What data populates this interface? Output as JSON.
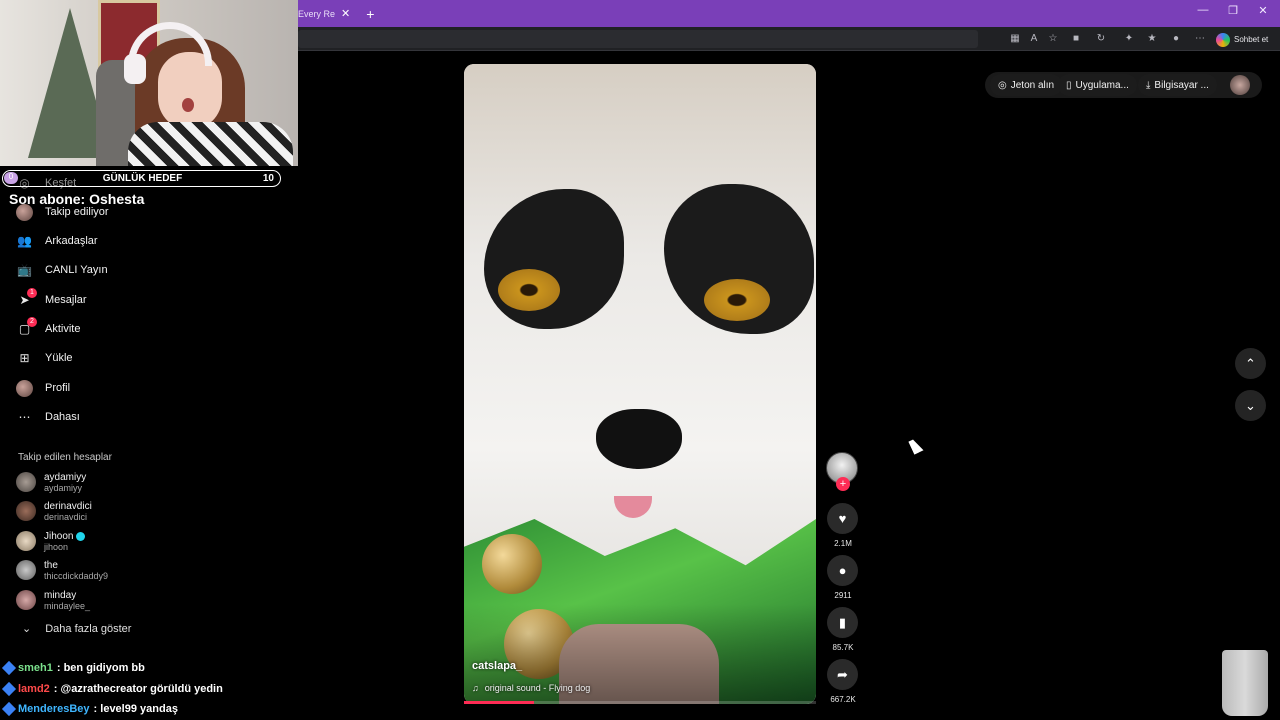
{
  "browser": {
    "tab_fragment": "Every Re",
    "copilot_label": "Sohbet et"
  },
  "goal": {
    "label": "GÜNLÜK HEDEF",
    "current": "0",
    "target": "10",
    "progress_fraction": 0.0
  },
  "last_sub": "Son abone: Oshesta",
  "sidebar": {
    "items": [
      {
        "label": "Keşfet",
        "icon": "compass-icon"
      },
      {
        "label": "Takip ediliyor",
        "icon": "avatar-icon"
      },
      {
        "label": "Arkadaşlar",
        "icon": "friends-icon"
      },
      {
        "label": "CANLI Yayın",
        "icon": "live-tv-icon"
      },
      {
        "label": "Mesajlar",
        "icon": "paper-plane-icon",
        "badge": "1"
      },
      {
        "label": "Aktivite",
        "icon": "activity-icon",
        "badge": "2"
      },
      {
        "label": "Yükle",
        "icon": "upload-plus-icon"
      },
      {
        "label": "Profil",
        "icon": "profile-avatar-icon"
      },
      {
        "label": "Dahası",
        "icon": "more-dots-icon"
      }
    ],
    "following_title": "Takip edilen hesaplar",
    "accounts": [
      {
        "name": "aydamiyy",
        "handle": "aydamiyy",
        "verified": false
      },
      {
        "name": "derinavdici",
        "handle": "derinavdici",
        "verified": false
      },
      {
        "name": "Jihoon",
        "handle": "jihoon",
        "verified": true
      },
      {
        "name": "the",
        "handle": "thiccdickdaddy9",
        "verified": false
      },
      {
        "name": "minday",
        "handle": "mindaylee_",
        "verified": false
      }
    ],
    "show_more": "Daha fazla göster"
  },
  "chat": [
    {
      "user": "smeh1",
      "text": ": ben gidiyom bb",
      "color": "#7be08c"
    },
    {
      "user": "lamd2",
      "text": ": @azrathecreator görüldü yedin",
      "color": "#ff4a4a"
    },
    {
      "user": "MenderesBey",
      "text": ": level99 yandaş",
      "color": "#3fb6ff"
    }
  ],
  "video": {
    "username": "catslapa_",
    "sound": "original sound - Flying dog",
    "progress_fraction": 0.2
  },
  "actions": {
    "likes": "2.1M",
    "comments": "2911",
    "saves": "85.7K",
    "shares": "667.2K"
  },
  "topbar": {
    "coins": "Jeton alın",
    "app": "Uygulama...",
    "desktop": "Bilgisayar ..."
  },
  "colors": {
    "accent": "#fe2c55",
    "browser_titlebar": "#7a3fb8",
    "goal_fill": "#c9a3e6"
  }
}
